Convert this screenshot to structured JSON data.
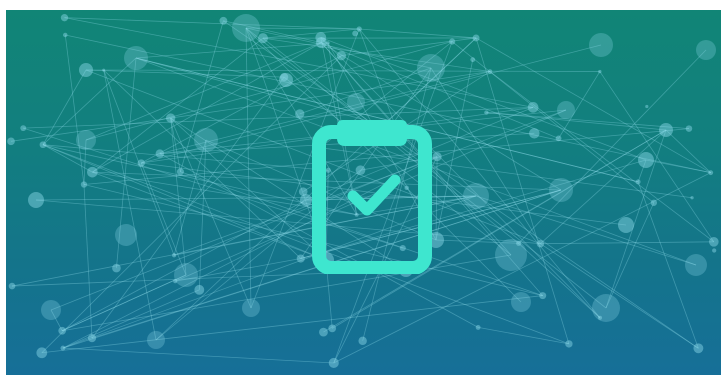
{
  "banner": {
    "background_top": "#118576",
    "background_bottom": "#166f98",
    "network_color": "#7fd6e6",
    "icon": "clipboard-check-icon",
    "icon_color": "#3ee6cf"
  }
}
